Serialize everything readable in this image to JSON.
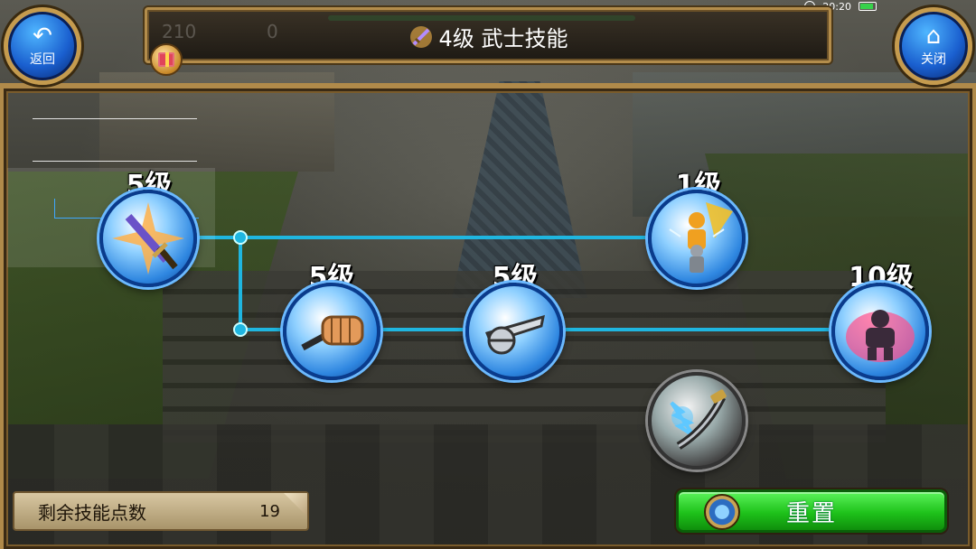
{
  "header": {
    "title": "4级 武士技能",
    "faint_left_value": "210",
    "faint_right_value": "0"
  },
  "nav": {
    "back_label": "返回",
    "close_label": "关闭"
  },
  "status_bar": {
    "time": "20:20"
  },
  "skills": [
    {
      "id": "katana-strike",
      "level": "5级",
      "icon": "sword-burst-icon",
      "state": "unlocked"
    },
    {
      "id": "fist-strike",
      "level": "5级",
      "icon": "fist-sword-icon",
      "state": "unlocked"
    },
    {
      "id": "blade-slash",
      "level": "5级",
      "icon": "blade-slash-icon",
      "state": "unlocked"
    },
    {
      "id": "aura-boost",
      "level": "1级",
      "icon": "aura-warrior-icon",
      "state": "unlocked"
    },
    {
      "id": "power-stance",
      "level": "10级",
      "icon": "power-stance-icon",
      "state": "unlocked"
    },
    {
      "id": "lightning-blade",
      "level": "",
      "icon": "lightning-blade-icon",
      "state": "locked"
    }
  ],
  "skill_points": {
    "label": "剩余技能点数",
    "value": "19"
  },
  "reset": {
    "label": "重置"
  },
  "colors": {
    "connector": "#1fb6e0",
    "frame_gold": "#b08a4a",
    "reset_green": "#1ec21a",
    "skill_blue": "#2e86e0"
  }
}
